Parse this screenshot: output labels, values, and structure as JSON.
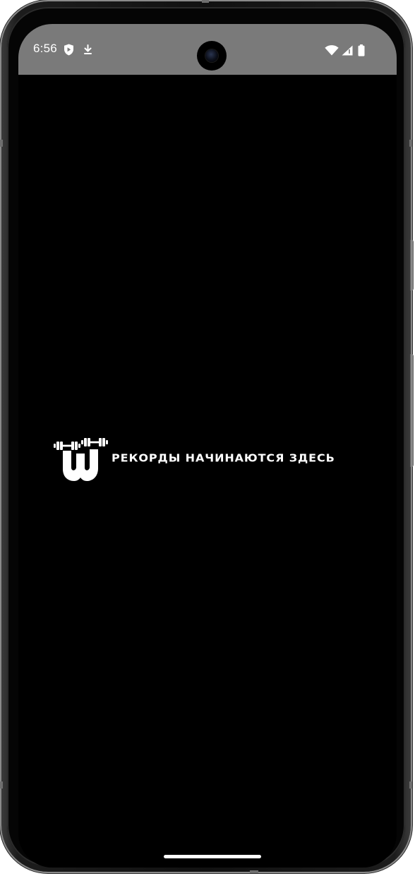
{
  "status_bar": {
    "time": "6:56",
    "icons": [
      "shield-icon",
      "download-icon",
      "wifi-icon",
      "signal-icon",
      "battery-icon"
    ]
  },
  "splash": {
    "logo": "dumbbell-w-logo",
    "tagline": "РЕКОРДЫ НАЧИНАЮТСЯ ЗДЕСЬ"
  },
  "colors": {
    "screen_background": "#000000",
    "status_bar_background": "#7a7a7a",
    "foreground": "#ffffff"
  }
}
